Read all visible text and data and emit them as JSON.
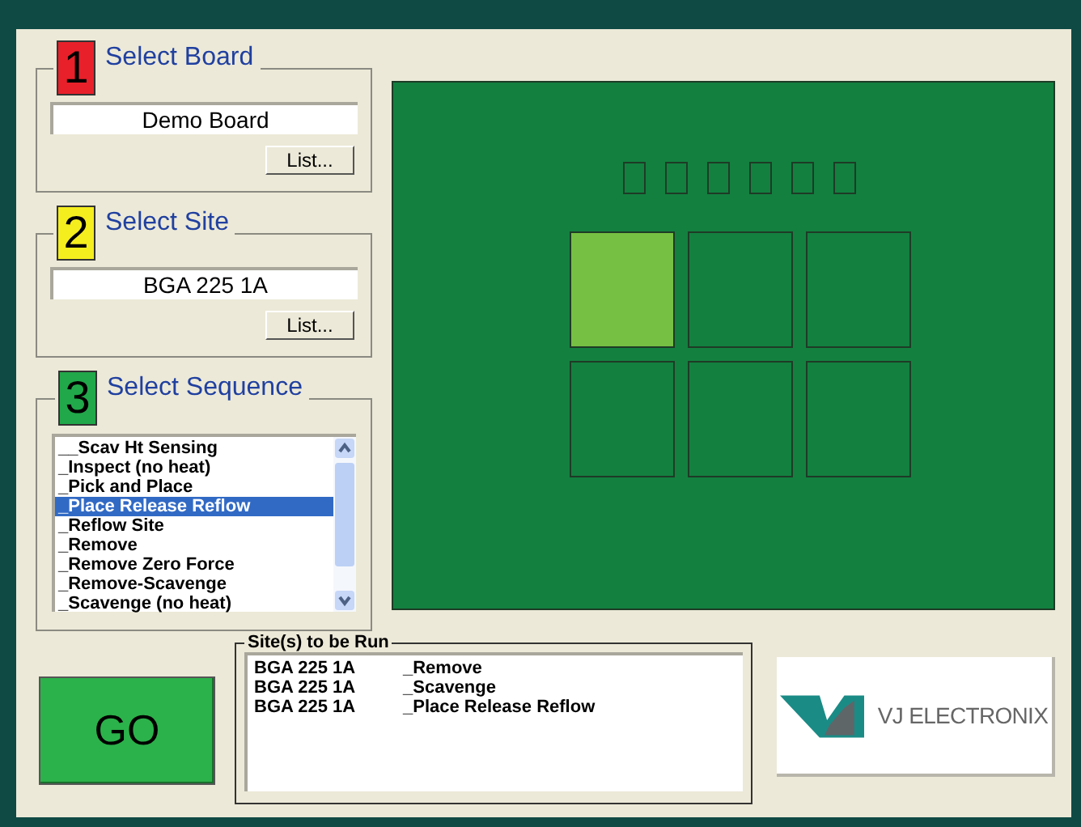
{
  "groups": [
    {
      "number": "1",
      "color": "#e8202a",
      "title": "Select Board",
      "value": "Demo Board",
      "button": "List..."
    },
    {
      "number": "2",
      "color": "#f5ee1e",
      "title": "Select Site",
      "value": "BGA 225 1A",
      "button": "List..."
    }
  ],
  "sequence": {
    "number": "3",
    "color": "#21a84a",
    "title": "Select Sequence",
    "items": [
      {
        "label": "__Scav Ht Sensing",
        "selected": false
      },
      {
        "label": "_Inspect (no heat)",
        "selected": false
      },
      {
        "label": "_Pick and Place",
        "selected": false
      },
      {
        "label": "_Place Release Reflow",
        "selected": true
      },
      {
        "label": "_Reflow Site",
        "selected": false
      },
      {
        "label": "_Remove",
        "selected": false
      },
      {
        "label": "_Remove Zero Force",
        "selected": false
      },
      {
        "label": "_Remove-Scavenge",
        "selected": false
      },
      {
        "label": "_Scavenge (no heat)",
        "selected": false
      }
    ]
  },
  "board": {
    "sites": [
      {
        "selected": true
      },
      {
        "selected": false
      },
      {
        "selected": false
      },
      {
        "selected": false
      },
      {
        "selected": false
      },
      {
        "selected": false
      }
    ]
  },
  "go_button": "GO",
  "sites_to_run": {
    "title": "Site(s) to be Run",
    "rows": [
      {
        "site": "BGA 225 1A",
        "sequence": "_Remove"
      },
      {
        "site": "BGA 225 1A",
        "sequence": "_Scavenge"
      },
      {
        "site": "BGA 225 1A",
        "sequence": "_Place Release Reflow"
      }
    ]
  },
  "logo": {
    "text": "VJ ELECTRONIX"
  }
}
